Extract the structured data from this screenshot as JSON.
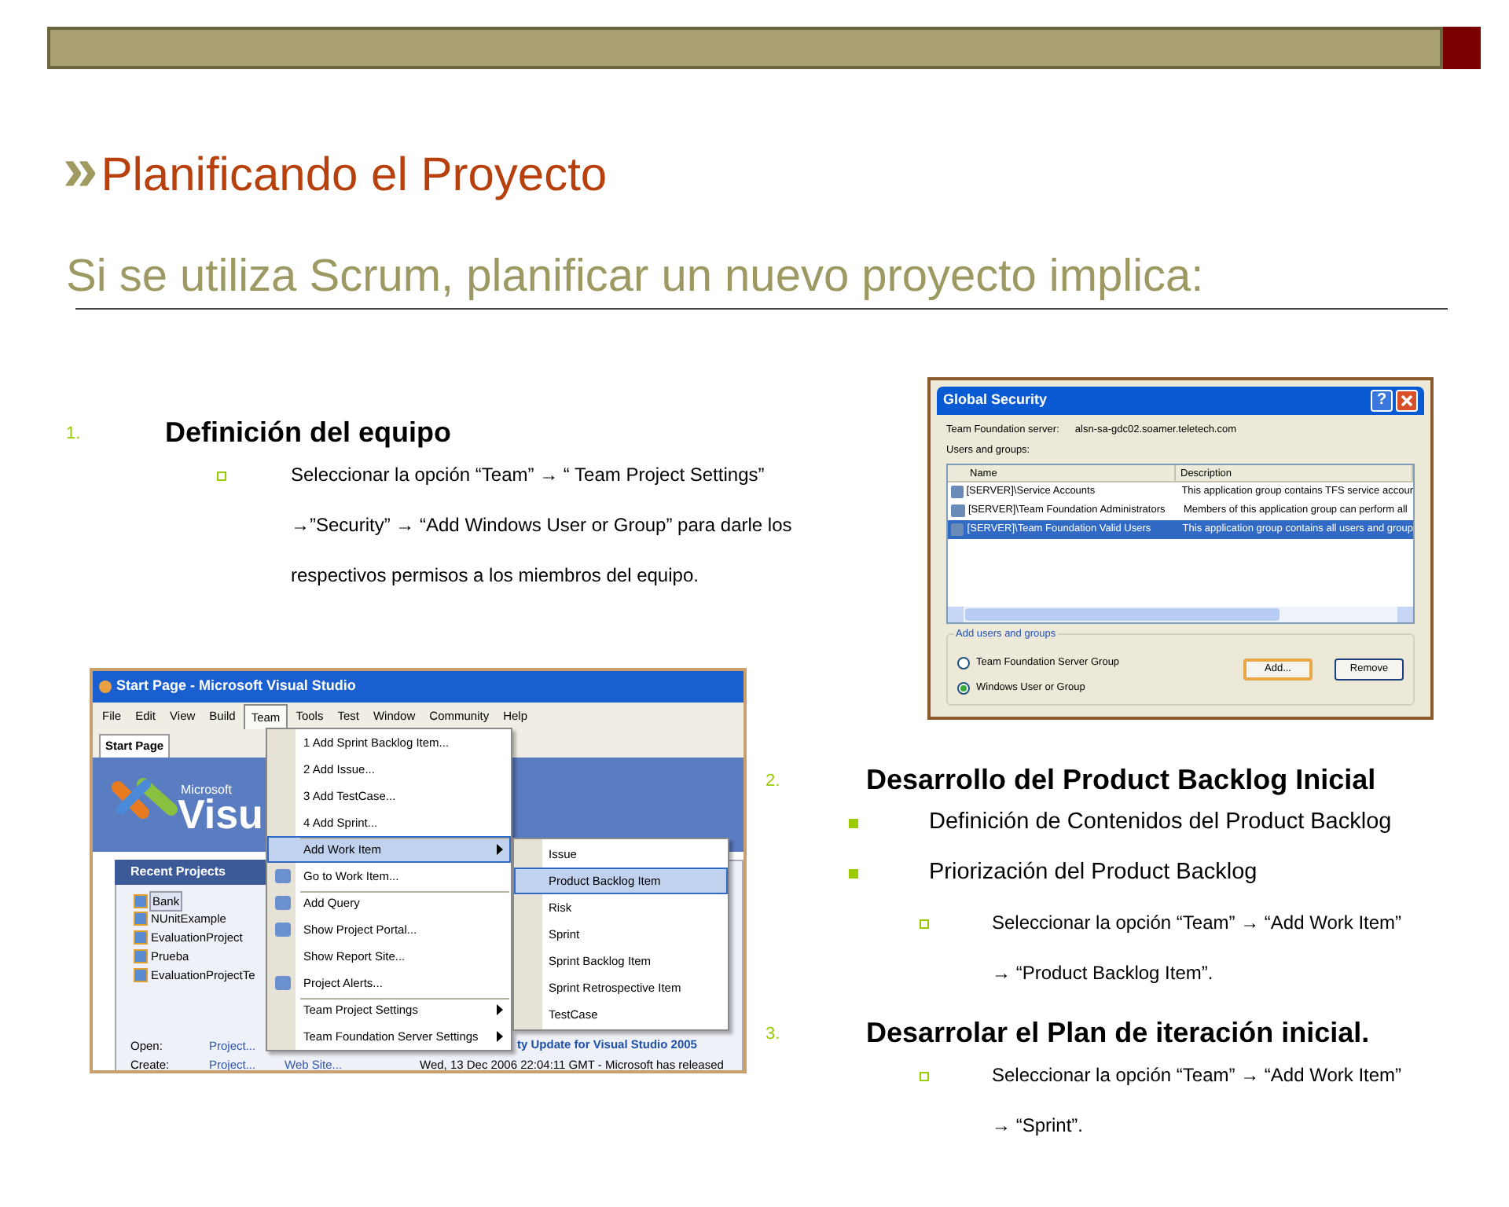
{
  "title_mark": "»",
  "title": "Planificando el Proyecto",
  "subtitle": "Si se utiliza Scrum, planificar un nuevo proyecto implica:",
  "sections": [
    {
      "number": "1.",
      "heading": "Definición del equipo",
      "bullets": [
        {
          "kind": "hollow",
          "lines": [
            "Seleccionar la opción “Team” → “ Team  Project Settings”",
            "→”Security” → “Add Windows User or Group”  para darle los",
            "respectivos permisos a los miembros del equipo."
          ]
        }
      ]
    },
    {
      "number": "2.",
      "heading": "Desarrollo del Product Backlog Inicial",
      "bullets": [
        {
          "kind": "filled",
          "lines": [
            "Definición de Contenidos del Product Backlog"
          ]
        },
        {
          "kind": "filled",
          "lines": [
            "Priorización del Product Backlog"
          ],
          "children": [
            {
              "kind": "hollow",
              "lines": [
                "Seleccionar la opción “Team” → “Add Work Item”",
                "→ “Product Backlog Item”."
              ]
            }
          ]
        }
      ]
    },
    {
      "number": "3.",
      "heading": "Desarrolar el Plan de iteración inicial.",
      "bullets": [
        {
          "kind": "hollow",
          "lines": [
            "Seleccionar la opción “Team” → “Add Work Item”",
            "→ “Sprint”."
          ]
        }
      ]
    }
  ],
  "security_dialog": {
    "title": "Global Security",
    "help_glyph": "?",
    "server_label": "Team Foundation server:",
    "server_value": "alsn-sa-gdc02.soamer.teletech.com",
    "list_label": "Users and groups:",
    "columns": [
      "Name",
      "Description"
    ],
    "rows": [
      {
        "name": "[SERVER]\\Service Accounts",
        "description": "This application group contains TFS service accour",
        "selected": false
      },
      {
        "name": "[SERVER]\\Team Foundation Administrators",
        "description": "Members of this application group can perform all",
        "selected": false
      },
      {
        "name": "[SERVER]\\Team Foundation Valid Users",
        "description": "This application group contains all users and group",
        "selected": true
      }
    ],
    "group_title": "Add users and groups",
    "radios": [
      {
        "label": "Team Foundation Server Group",
        "selected": false
      },
      {
        "label": "Windows User or Group",
        "selected": true
      }
    ],
    "buttons": [
      {
        "label": "Add...",
        "default": true
      },
      {
        "label": "Remove",
        "default": false
      }
    ]
  },
  "vs_window": {
    "title": "Start Page - Microsoft Visual Studio",
    "menu": [
      {
        "label": "File",
        "selected": false
      },
      {
        "label": "Edit",
        "selected": false
      },
      {
        "label": "View",
        "selected": false
      },
      {
        "label": "Build",
        "selected": false
      },
      {
        "label": "Team",
        "selected": true
      },
      {
        "label": "Tools",
        "selected": false
      },
      {
        "label": "Test",
        "selected": false
      },
      {
        "label": "Window",
        "selected": false
      },
      {
        "label": "Community",
        "selected": false
      },
      {
        "label": "Help",
        "selected": false
      }
    ],
    "tab": "Start Page",
    "logo_small": "Microsoft",
    "logo_big": "Visu",
    "recent_title": "Recent Projects",
    "projects": [
      {
        "label": "Bank",
        "selected": true
      },
      {
        "label": "NUnitExample",
        "selected": false
      },
      {
        "label": "EvaluationProject",
        "selected": false
      },
      {
        "label": "Prueba",
        "selected": false
      },
      {
        "label": "EvaluationProjectTe",
        "selected": false
      }
    ],
    "links": [
      {
        "label": "Open:",
        "value": "Project..."
      },
      {
        "label": "Create:",
        "value": "Project..."
      }
    ],
    "web_site": "Web Site...",
    "news_title": "ty Update for Visual Studio 2005",
    "news_text": "Wed, 13 Dec 2006 22:04:11 GMT - Microsoft has released",
    "team_menu": [
      {
        "label": "1 Add Sprint Backlog Item...",
        "selected": false,
        "submenu": false,
        "has_icon": false,
        "separator_before": false
      },
      {
        "label": "2 Add Issue...",
        "selected": false,
        "submenu": false,
        "has_icon": false,
        "separator_before": false
      },
      {
        "label": "3 Add TestCase...",
        "selected": false,
        "submenu": false,
        "has_icon": false,
        "separator_before": false
      },
      {
        "label": "4 Add Sprint...",
        "selected": false,
        "submenu": false,
        "has_icon": false,
        "separator_before": false
      },
      {
        "label": "Add Work Item",
        "selected": true,
        "submenu": true,
        "has_icon": false,
        "separator_before": true
      },
      {
        "label": "Go to Work Item...",
        "selected": false,
        "submenu": false,
        "has_icon": true,
        "separator_before": false
      },
      {
        "label": "Add Query",
        "selected": false,
        "submenu": false,
        "has_icon": true,
        "separator_before": true
      },
      {
        "label": "Show Project Portal...",
        "selected": false,
        "submenu": false,
        "has_icon": true,
        "separator_before": false
      },
      {
        "label": "Show Report Site...",
        "selected": false,
        "submenu": false,
        "has_icon": false,
        "separator_before": false
      },
      {
        "label": "Project Alerts...",
        "selected": false,
        "submenu": false,
        "has_icon": true,
        "separator_before": false
      },
      {
        "label": "Team Project Settings",
        "selected": false,
        "submenu": true,
        "has_icon": false,
        "separator_before": true
      },
      {
        "label": "Team Foundation Server Settings",
        "selected": false,
        "submenu": true,
        "has_icon": false,
        "separator_before": false
      }
    ],
    "work_item_menu": [
      {
        "label": "Issue",
        "selected": false
      },
      {
        "label": "Product Backlog Item",
        "selected": true
      },
      {
        "label": "Risk",
        "selected": false
      },
      {
        "label": "Sprint",
        "selected": false
      },
      {
        "label": "Sprint Backlog Item",
        "selected": false
      },
      {
        "label": "Sprint Retrospective Item",
        "selected": false
      },
      {
        "label": "TestCase",
        "selected": false
      }
    ]
  }
}
